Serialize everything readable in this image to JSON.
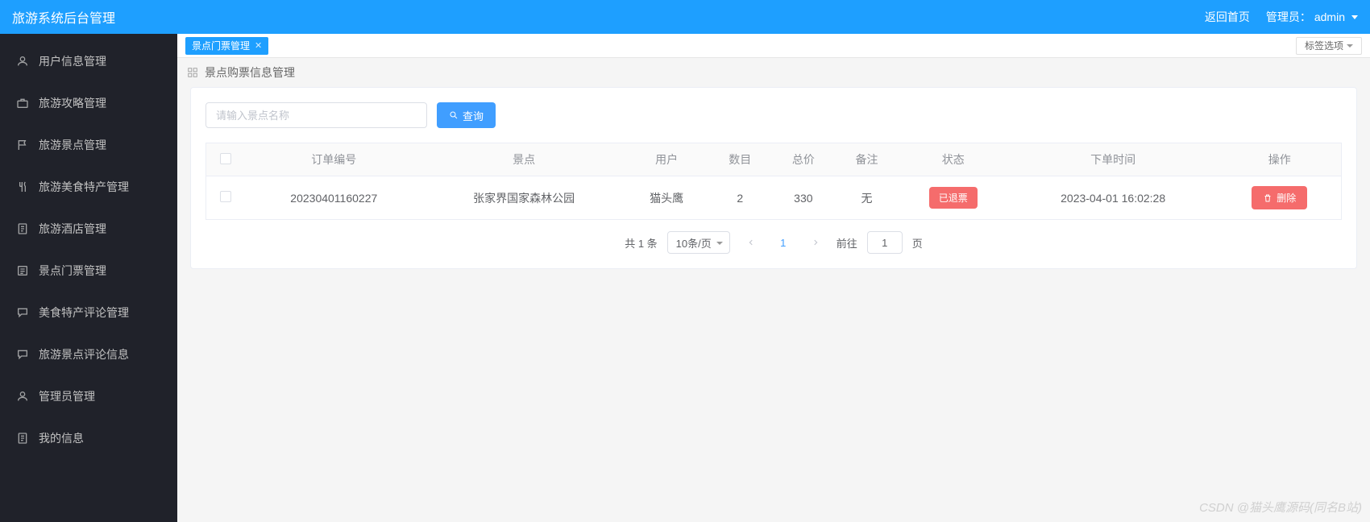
{
  "header": {
    "title": "旅游系统后台管理",
    "back_home": "返回首页",
    "admin_prefix": "管理员：",
    "admin_name": "admin"
  },
  "sidebar": {
    "items": [
      {
        "label": "用户信息管理",
        "icon": "user"
      },
      {
        "label": "旅游攻略管理",
        "icon": "briefcase"
      },
      {
        "label": "旅游景点管理",
        "icon": "flag"
      },
      {
        "label": "旅游美食特产管理",
        "icon": "food"
      },
      {
        "label": "旅游酒店管理",
        "icon": "doc"
      },
      {
        "label": "景点门票管理",
        "icon": "ticket"
      },
      {
        "label": "美食特产评论管理",
        "icon": "comment"
      },
      {
        "label": "旅游景点评论信息",
        "icon": "comment"
      },
      {
        "label": "管理员管理",
        "icon": "admin"
      },
      {
        "label": "我的信息",
        "icon": "doc"
      }
    ]
  },
  "tabs": {
    "items": [
      {
        "label": "景点门票管理"
      }
    ],
    "options_label": "标签选项"
  },
  "breadcrumb": {
    "title": "景点购票信息管理"
  },
  "search": {
    "placeholder": "请输入景点名称",
    "button_label": "查询"
  },
  "table": {
    "columns": [
      "订单编号",
      "景点",
      "用户",
      "数目",
      "总价",
      "备注",
      "状态",
      "下单时间",
      "操作"
    ],
    "rows": [
      {
        "order_no": "20230401160227",
        "spot": "张家界国家森林公园",
        "user": "猫头鹰",
        "qty": "2",
        "total": "330",
        "remark": "无",
        "status": "已退票",
        "time": "2023-04-01 16:02:28",
        "action": "删除"
      }
    ]
  },
  "pagination": {
    "total_text": "共 1 条",
    "page_size_label": "10条/页",
    "current": "1",
    "jump_prefix": "前往",
    "jump_value": "1",
    "jump_suffix": "页"
  },
  "watermark": "CSDN @猫头鹰源码(同名B站)"
}
